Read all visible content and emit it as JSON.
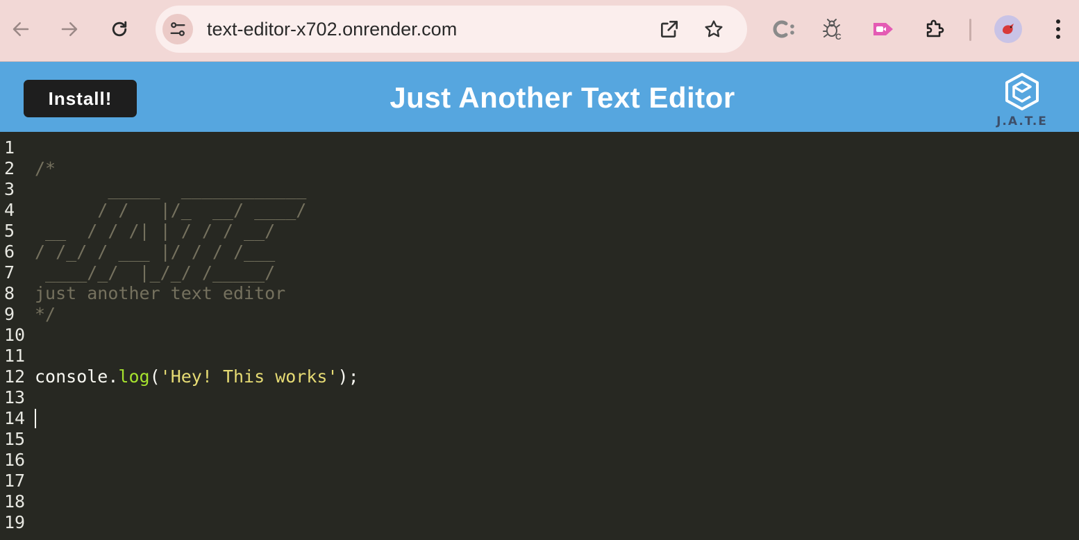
{
  "browser": {
    "url": "text-editor-x702.onrender.com"
  },
  "app": {
    "install_label": "Install!",
    "title": "Just Another Text Editor",
    "logo_text": "J.A.T.E"
  },
  "editor": {
    "lines": [
      {
        "n": "1",
        "segments": []
      },
      {
        "n": "2",
        "segments": [
          {
            "t": "/*",
            "c": "cm"
          }
        ]
      },
      {
        "n": "3",
        "segments": [
          {
            "t": "       _____  ____________",
            "c": "cm"
          }
        ]
      },
      {
        "n": "4",
        "segments": [
          {
            "t": "      / /   |/_  __/ ____/",
            "c": "cm"
          }
        ]
      },
      {
        "n": "5",
        "segments": [
          {
            "t": " __  / / /| | / / / __/",
            "c": "cm"
          }
        ]
      },
      {
        "n": "6",
        "segments": [
          {
            "t": "/ /_/ / ___ |/ / / /___",
            "c": "cm"
          }
        ]
      },
      {
        "n": "7",
        "segments": [
          {
            "t": " ____/_/  |_/_/ /_____/",
            "c": "cm"
          }
        ]
      },
      {
        "n": "8",
        "segments": [
          {
            "t": "just another text editor",
            "c": "cm"
          }
        ]
      },
      {
        "n": "9",
        "segments": [
          {
            "t": "*/",
            "c": "cm"
          }
        ]
      },
      {
        "n": "10",
        "segments": []
      },
      {
        "n": "11",
        "segments": []
      },
      {
        "n": "12",
        "segments": [
          {
            "t": "console.",
            "c": ""
          },
          {
            "t": "log",
            "c": "prop"
          },
          {
            "t": "(",
            "c": ""
          },
          {
            "t": "'Hey! This works'",
            "c": "str"
          },
          {
            "t": ");",
            "c": ""
          }
        ]
      },
      {
        "n": "13",
        "segments": []
      },
      {
        "n": "14",
        "segments": []
      },
      {
        "n": "15",
        "segments": []
      },
      {
        "n": "16",
        "segments": []
      },
      {
        "n": "17",
        "segments": []
      },
      {
        "n": "18",
        "segments": []
      },
      {
        "n": "19",
        "segments": []
      }
    ],
    "cursor_line": 14
  }
}
